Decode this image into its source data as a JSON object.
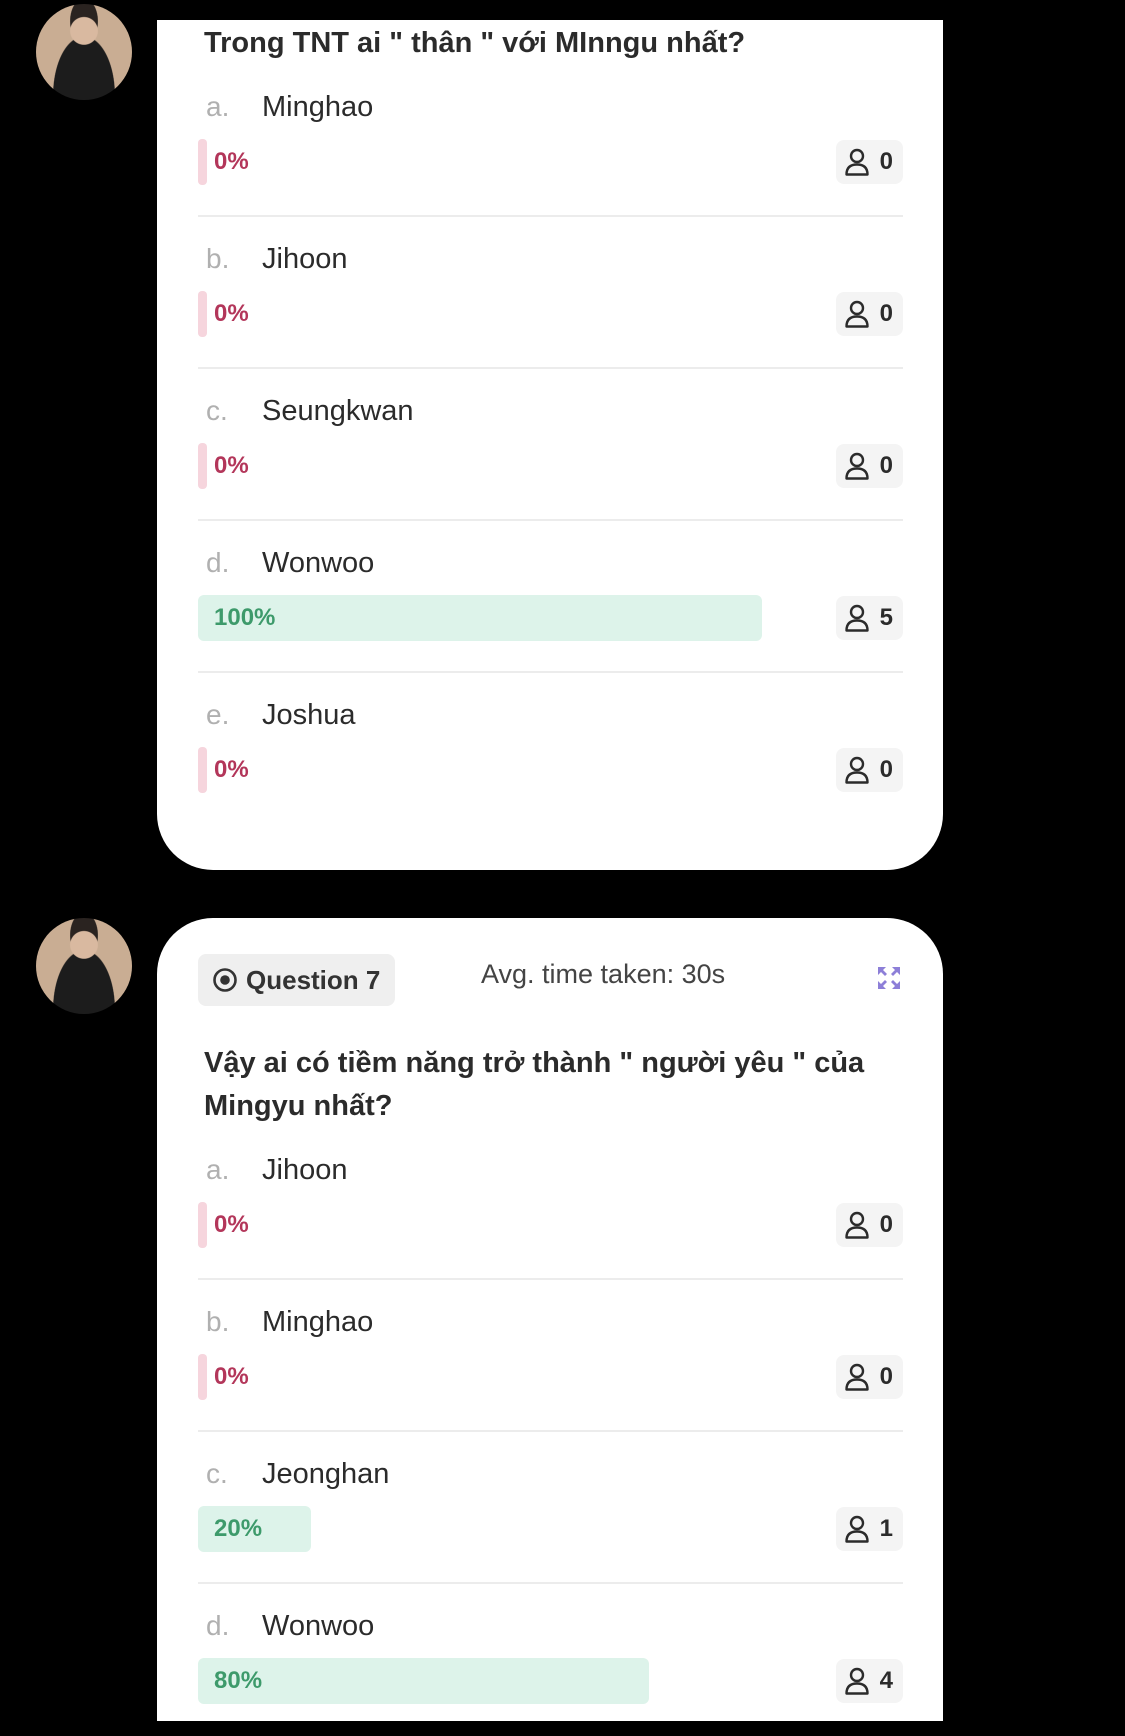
{
  "accent": {
    "zero_bar": "#f6d5dd",
    "pos_bar": "#ddf3ea",
    "zero_text": "#b3365a",
    "pos_text": "#3d9a6b",
    "expand": "#8d7fd8"
  },
  "icons": {
    "participants": "user-icon",
    "question": "radio-target-icon",
    "expand": "expand-icon"
  },
  "card1": {
    "question": "Trong TNT ai \" thân \" với MInngu nhất?",
    "options": [
      {
        "letter": "a.",
        "text": "Minghao",
        "percent_label": "0%",
        "percent": 0,
        "count": "0"
      },
      {
        "letter": "b.",
        "text": "Jihoon",
        "percent_label": "0%",
        "percent": 0,
        "count": "0"
      },
      {
        "letter": "c.",
        "text": "Seungkwan",
        "percent_label": "0%",
        "percent": 0,
        "count": "0"
      },
      {
        "letter": "d.",
        "text": "Wonwoo",
        "percent_label": "100%",
        "percent": 100,
        "count": "5"
      },
      {
        "letter": "e.",
        "text": "Joshua",
        "percent_label": "0%",
        "percent": 0,
        "count": "0"
      }
    ]
  },
  "card2": {
    "question_label": "Question 7",
    "avg_time": "Avg. time taken: 30s",
    "question": "Vậy ai có tiềm năng trở thành \" người yêu \" của Mingyu nhất?",
    "options": [
      {
        "letter": "a.",
        "text": "Jihoon",
        "percent_label": "0%",
        "percent": 0,
        "count": "0"
      },
      {
        "letter": "b.",
        "text": "Minghao",
        "percent_label": "0%",
        "percent": 0,
        "count": "0"
      },
      {
        "letter": "c.",
        "text": "Jeonghan",
        "percent_label": "20%",
        "percent": 20,
        "count": "1"
      },
      {
        "letter": "d.",
        "text": "Wonwoo",
        "percent_label": "80%",
        "percent": 80,
        "count": "4"
      }
    ]
  }
}
